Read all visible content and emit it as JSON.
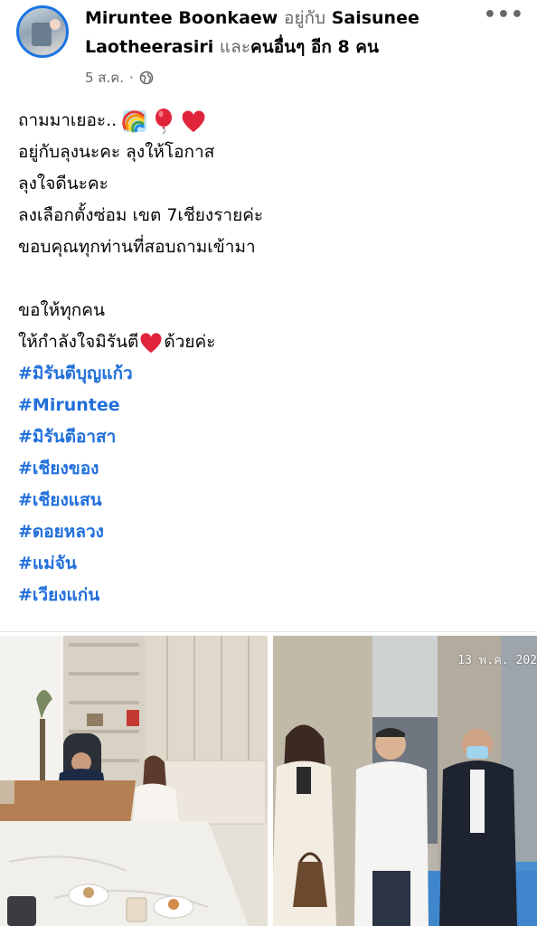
{
  "header": {
    "author": "Miruntee Boonkaew",
    "with_label": "อยู่กับ",
    "tagged_first": "Saisunee",
    "tagged_first_line2": "Laotheerasiri",
    "and_label": "และ",
    "others": "คนอื่นๆ อีก 8 คน"
  },
  "meta": {
    "date": "5 ส.ค.",
    "separator": "·",
    "privacy_icon": "globe-icon"
  },
  "more_icon": "more-options-icon",
  "post": {
    "line1": "ถามมาเยอะ..",
    "line2": "อยู่กับลุงนะคะ ลุงให้โอกาส",
    "line3": "ลุงใจดีนะคะ",
    "line4": "ลงเลือกตั้งซ่อม เขต 7เชียงรายค่ะ",
    "line5": "ขอบคุณทุกท่านที่สอบถามเข้ามา",
    "line6": "ขอให้ทุกคน",
    "line7_a": "ให้กำลังใจมิรันตี",
    "line7_b": "ด้วยค่ะ",
    "hashtags": [
      "#มิรันตีบุญแก้ว",
      "#Miruntee",
      "#มิรันตีอาสา",
      "#เชียงของ",
      "#เชียงแสน",
      "#ดอยหลวง",
      "#แม่จัน",
      "#เวียงแก่น"
    ]
  },
  "photos": {
    "right_timestamp": "13 พ.ค. 202"
  },
  "colors": {
    "hashtag": "#216fdb",
    "avatar_ring": "#1b74e4",
    "secondary_text": "#65676b",
    "heart": "#e0243a"
  }
}
